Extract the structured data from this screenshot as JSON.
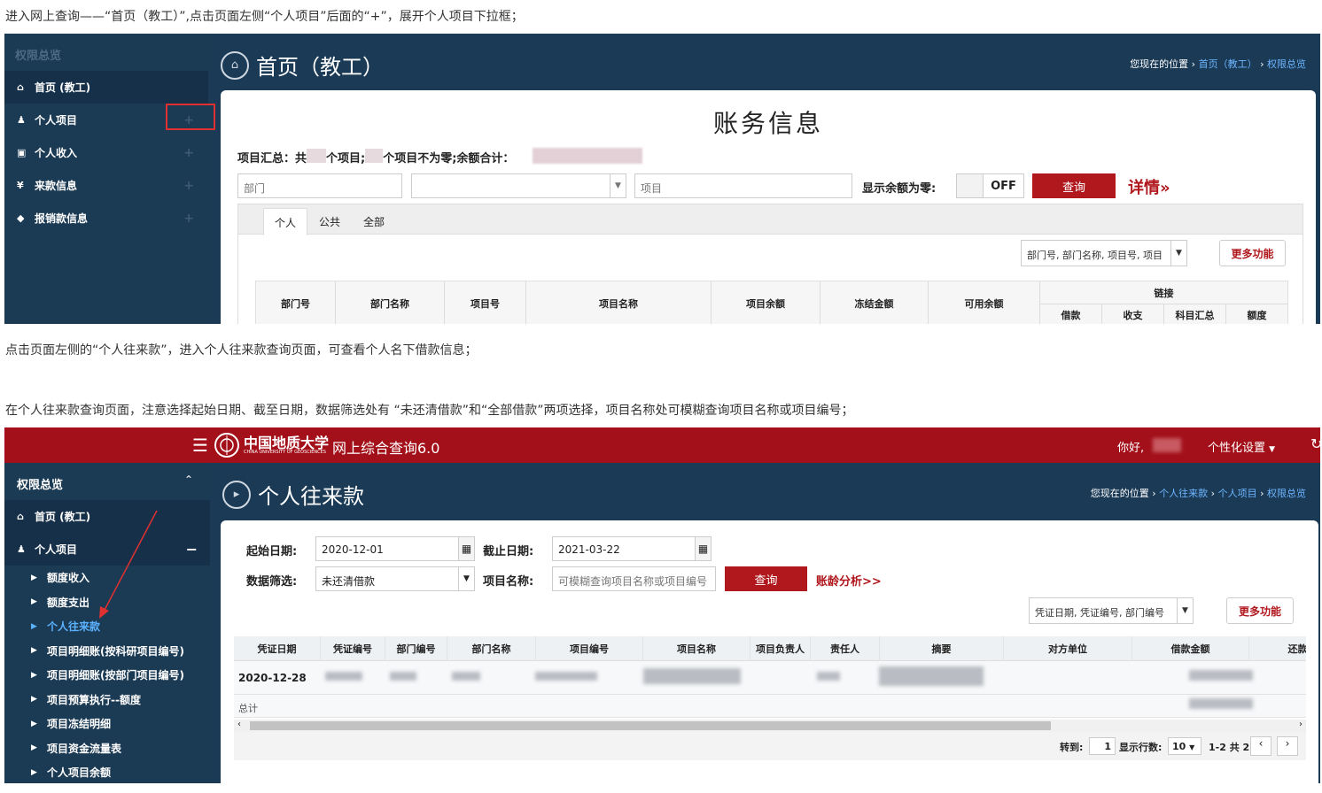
{
  "notes": {
    "n1": "进入网上查询——“首页（教工）”,点击页面左侧“个人项目”后面的“+”，展开个人项目下拉框；",
    "n2": "点击页面左侧的“个人往来款”，进入个人往来款查询页面，可查看个人名下借款信息；",
    "n3": "在个人往来款查询页面，注意选择起始日期、截至日期，数据筛选处有 “未还清借款”和“全部借款”两项选择，项目名称处可模糊查询项目名称或项目编号；"
  },
  "shot1": {
    "sidebar_header": "权限总览",
    "sidebar_items": [
      {
        "icon": "home-icon",
        "glyph": "⌂",
        "label": "首页 (教工)",
        "plus": ""
      },
      {
        "icon": "user-icon",
        "glyph": "♟",
        "label": "个人项目",
        "plus": "+"
      },
      {
        "icon": "money-icon",
        "glyph": "▣",
        "label": "个人收入",
        "plus": "+"
      },
      {
        "icon": "yen-icon",
        "glyph": "¥",
        "label": "来款信息",
        "plus": "+"
      },
      {
        "icon": "tag-icon",
        "glyph": "◆",
        "label": "报销款信息",
        "plus": "+"
      }
    ],
    "page_title": "首页（教工）",
    "breadcrumb_prefix": "您现在的位置",
    "breadcrumb_links": [
      "首页（教工）",
      "权限总览"
    ],
    "panel_title": "账务信息",
    "summary": {
      "a": "项目汇总：共",
      "b": "个项目;",
      "c": "个项目不为零;余额合计："
    },
    "dept_placeholder": "部门",
    "project_placeholder": "项目",
    "show_zero_label": "显示余额为零:",
    "toggle_value": "OFF",
    "query_button": "查询",
    "details_link": "详情»",
    "tabs": [
      "个人",
      "公共",
      "全部"
    ],
    "column_select": "部门号, 部门名称, 项目号, 项目",
    "more_button": "更多功能",
    "columns": [
      "部门号",
      "部门名称",
      "项目号",
      "项目名称",
      "项目余额",
      "冻结金额",
      "可用余额"
    ],
    "link_group": "链接",
    "link_columns": [
      "借款",
      "收支",
      "科目汇总",
      "额度"
    ]
  },
  "shot2": {
    "menu_icon": "☰",
    "university": "中国地质大学",
    "university_en": "CHINA UNIVERSITY OF GEOSCIENCES",
    "app_name": "网上综合查询6.0",
    "greeting": "你好,",
    "personal_settings": "个性化设置",
    "sidebar_header": "权限总览",
    "home_item": "首页 (教工)",
    "project_item": "个人项目",
    "minus": "−",
    "sub_items": [
      "额度收入",
      "额度支出",
      "个人往来款",
      "项目明细账(按科研项目编号)",
      "项目明细账(按部门项目编号)",
      "项目预算执行--额度",
      "项目冻结明细",
      "项目资金流量表",
      "个人项目余额"
    ],
    "page_title": "个人往来款",
    "breadcrumb_prefix": "您现在的位置",
    "breadcrumb_links": [
      "个人往来款",
      "个人项目",
      "权限总览"
    ],
    "start_label": "起始日期:",
    "start_value": "2020-12-01",
    "end_label": "截止日期:",
    "end_value": "2021-03-22",
    "filter_label": "数据筛选:",
    "filter_value": "未还清借款",
    "project_label": "项目名称:",
    "project_placeholder": "可模糊查询项目名称或项目编号",
    "query_button": "查询",
    "analysis_link": "账龄分析>>",
    "column_select": "凭证日期, 凭证编号, 部门编号",
    "more_button": "更多功能",
    "columns": [
      "凭证日期",
      "凭证编号",
      "部门编号",
      "部门名称",
      "项目编号",
      "项目名称",
      "项目负责人",
      "责任人",
      "摘要",
      "对方单位",
      "借款金额",
      "还款"
    ],
    "row_date": "2020-12-28",
    "total_label": "总计",
    "goto_label": "转到:",
    "goto_value": "1",
    "rows_label": "显示行数:",
    "rows_value": "10",
    "range_text": "1-2 共 2"
  }
}
